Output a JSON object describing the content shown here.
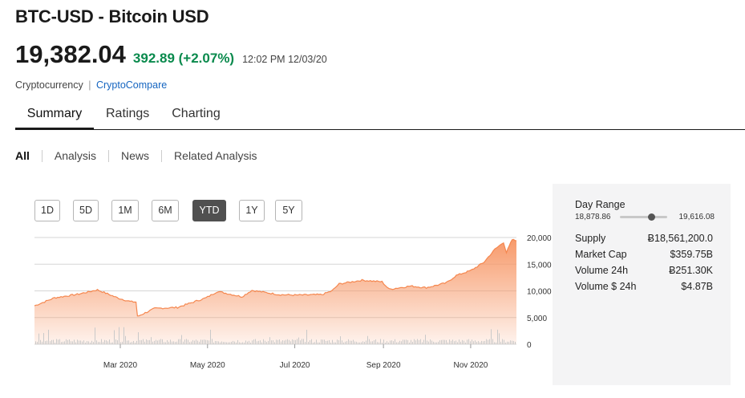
{
  "header": {
    "title": "BTC-USD  - Bitcoin USD",
    "price": "19,382.04",
    "change": "392.89 (+2.07%)",
    "timestamp": "12:02 PM 12/03/20",
    "category": "Cryptocurrency",
    "separator": "|",
    "source_link": "CryptoCompare",
    "change_color": "#0a8a4d"
  },
  "tabs": [
    "Summary",
    "Ratings",
    "Charting"
  ],
  "subnav": [
    "All",
    "Analysis",
    "News",
    "Related Analysis"
  ],
  "range_buttons": [
    "1D",
    "5D",
    "1M",
    "6M",
    "YTD",
    "1Y",
    "5Y"
  ],
  "active_range": "YTD",
  "day_range": {
    "label": "Day Range",
    "low": "18,878.86",
    "high": "19,616.08",
    "position": 0.67
  },
  "stats": [
    {
      "label": "Supply",
      "value": "Ƀ18,561,200.0"
    },
    {
      "label": "Market Cap",
      "value": "$359.75B"
    },
    {
      "label": "Volume 24h",
      "value": "Ƀ251.30K"
    },
    {
      "label": "Volume $ 24h",
      "value": "$4.87B"
    }
  ],
  "chart_data": {
    "type": "area",
    "title": "",
    "xlabel": "",
    "ylabel": "",
    "x_ticks": [
      "Mar 2020",
      "May 2020",
      "Jul 2020",
      "Sep 2020",
      "Nov 2020"
    ],
    "y_ticks": [
      "20,000",
      "15,000",
      "10,000",
      "5,000",
      "0"
    ],
    "ylim": [
      0,
      20000
    ],
    "fill_color": "#f79a6b",
    "series": [
      {
        "x": [
          "2020-01-01",
          "2020-01-15",
          "2020-02-01",
          "2020-02-14",
          "2020-02-29",
          "2020-03-08",
          "2020-03-12",
          "2020-03-13",
          "2020-03-25",
          "2020-04-10",
          "2020-04-30",
          "2020-05-08",
          "2020-05-25",
          "2020-06-01",
          "2020-06-20",
          "2020-07-01",
          "2020-07-20",
          "2020-07-27",
          "2020-08-01",
          "2020-08-17",
          "2020-08-31",
          "2020-09-05",
          "2020-09-20",
          "2020-10-01",
          "2020-10-15",
          "2020-10-22",
          "2020-11-01",
          "2020-11-10",
          "2020-11-18",
          "2020-11-24",
          "2020-11-26",
          "2020-11-30",
          "2020-12-03"
        ],
        "values": [
          7200,
          8700,
          9400,
          10200,
          8600,
          8000,
          7900,
          5200,
          6700,
          6900,
          8700,
          9900,
          8900,
          10100,
          9300,
          9200,
          9300,
          10000,
          11300,
          12000,
          11700,
          10300,
          10900,
          10600,
          11500,
          12900,
          13800,
          15300,
          17800,
          19100,
          17200,
          19600,
          19382
        ]
      }
    ],
    "volume_bars": true
  }
}
